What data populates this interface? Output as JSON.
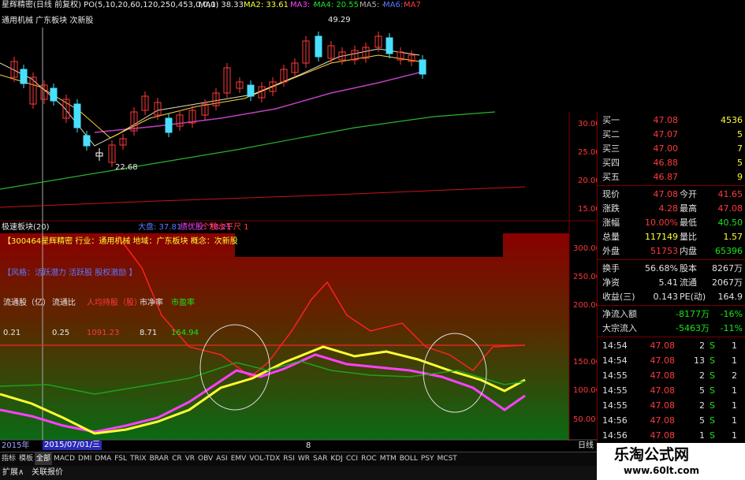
{
  "colors": {
    "red": "#ff3a3a",
    "green": "#19e619",
    "cyan": "#49e0ff",
    "magenta": "#ff40ff",
    "yellow": "#ffff33"
  },
  "header": {
    "title_line": "星辉精密(日线 前复权) PO(5,10,20,60,120,250,453,0,0,0)",
    "ma1": "MA1: 38.33",
    "ma2": "MA2: 33.61",
    "ma3": "MA3: -",
    "ma4": "MA4: 20.55",
    "ma5": "MA5: -",
    "ma6": "MA6: -",
    "ma7": "MA7",
    "sub_line": "通用机械 广东板块 次新股"
  },
  "main_chart": {
    "high_label": "49.29",
    "low_label": "22.68",
    "y_ticks": [
      "30.00",
      "25.00",
      "20.00",
      "15.00"
    ]
  },
  "indicator": {
    "name": "极速板块(20)",
    "readout_dapan": "大盘: 37.81",
    "readout_jiyou": "绩优股: 78.21",
    "readout_gushu": "个股水平尺 1",
    "info_line": "【300464星辉精密 行业：通用机械 地域：广东板块 概念：次新股",
    "style_line": "【风格：活跃潜力 活跃股 股权激励 】",
    "fund_headers": [
      "流通股（亿）",
      "流通比",
      "人均持股（股）",
      "市净率",
      "市盈率"
    ],
    "fund_values": [
      "0.21",
      "0.25",
      "1091.23",
      "8.71",
      "164.94"
    ],
    "y_ticks": [
      "300.00",
      "250.00",
      "200.00",
      "150.00",
      "100.00",
      "50.00"
    ]
  },
  "time_axis": {
    "year": "2015年",
    "date_cursor": "2015/07/01/三",
    "marker": "8",
    "period": "日线"
  },
  "tabs": [
    "指标",
    "模板",
    "全部",
    "MACD",
    "DMI",
    "DMA",
    "FSL",
    "TRIX",
    "BRAR",
    "CR",
    "VR",
    "OBV",
    "ASI",
    "EMV",
    "VOL-TDX",
    "RSI",
    "WR",
    "SAR",
    "KDJ",
    "CCI",
    "ROC",
    "MTM",
    "BOLL",
    "PSY",
    "MCST"
  ],
  "status_bar": [
    "扩展∧",
    "关联报价"
  ],
  "quote": {
    "orders": [
      {
        "label": "买一",
        "price": "47.08",
        "vol": "4536"
      },
      {
        "label": "买二",
        "price": "47.07",
        "vol": "5"
      },
      {
        "label": "买三",
        "price": "47.00",
        "vol": "7"
      },
      {
        "label": "买四",
        "price": "46.88",
        "vol": "5"
      },
      {
        "label": "买五",
        "price": "46.87",
        "vol": "9"
      }
    ],
    "stats": [
      [
        "现价",
        "47.08",
        "今开",
        "41.65"
      ],
      [
        "涨跌",
        "4.28",
        "最高",
        "47.08"
      ],
      [
        "涨幅",
        "10.00%",
        "最低",
        "40.50"
      ],
      [
        "总量",
        "117149",
        "量比",
        "1.57"
      ],
      [
        "外盘",
        "51753",
        "内盘",
        "65396"
      ]
    ],
    "stats2": [
      [
        "换手",
        "56.68%",
        "股本",
        "8267万"
      ],
      [
        "净资",
        "5.41",
        "流通",
        "2067万"
      ],
      [
        "收益(三)",
        "0.143",
        "PE(动)",
        "164.9"
      ]
    ],
    "flows": [
      {
        "label": "净流入额",
        "val": "-8177万",
        "pct": "-16%"
      },
      {
        "label": "大宗流入",
        "val": "-5463万",
        "pct": "-11%"
      }
    ],
    "ticks": [
      {
        "time": "14:54",
        "price": "47.08",
        "vol": "2",
        "side": "S",
        "n": "1"
      },
      {
        "time": "14:54",
        "price": "47.08",
        "vol": "13",
        "side": "S",
        "n": "1"
      },
      {
        "time": "14:55",
        "price": "47.08",
        "vol": "2",
        "side": "S",
        "n": "2"
      },
      {
        "time": "14:55",
        "price": "47.08",
        "vol": "5",
        "side": "S",
        "n": "1"
      },
      {
        "time": "14:55",
        "price": "47.08",
        "vol": "2",
        "side": "S",
        "n": "1"
      },
      {
        "time": "14:56",
        "price": "47.08",
        "vol": "5",
        "side": "S",
        "n": "1"
      },
      {
        "time": "14:56",
        "price": "47.08",
        "vol": "1",
        "side": "S",
        "n": "1"
      }
    ]
  },
  "brand": {
    "name": "乐淘公式网",
    "url": "www.60lt.com"
  }
}
